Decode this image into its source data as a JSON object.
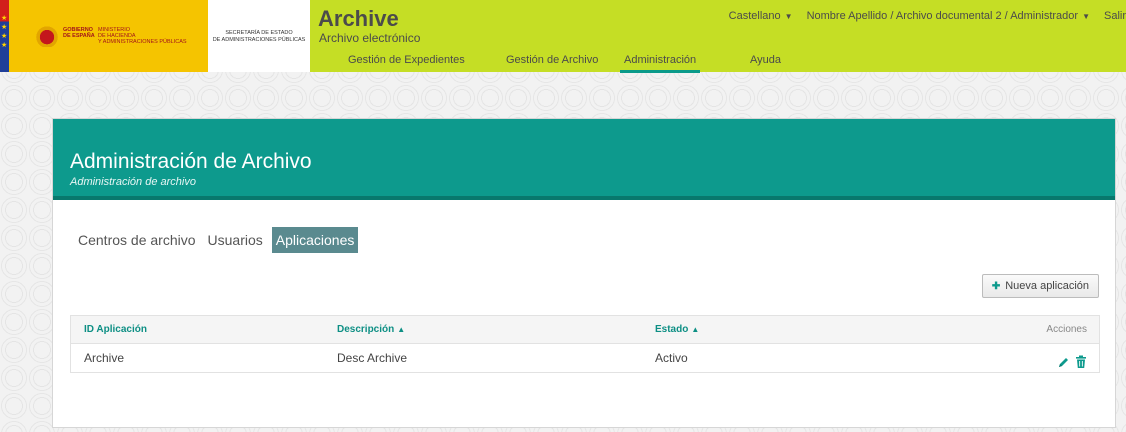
{
  "header": {
    "gov_line1": "GOBIERNO",
    "gov_line2": "DE ESPAÑA",
    "ministry_line1": "MINISTERIO",
    "ministry_line2": "DE HACIENDA",
    "ministry_line3": "Y ADMINISTRACIONES PÚBLICAS",
    "secretary_line1": "SECRETARÍA DE ESTADO",
    "secretary_line2": "DE ADMINISTRACIONES PÚBLICAS",
    "app_title": "Archive",
    "app_subtitle": "Archivo electrónico",
    "language": "Castellano",
    "user": "Nombre Apellido / Archivo documental 2 / Administrador",
    "logout": "Salir",
    "nav": [
      {
        "label": "Gestión de Expedientes"
      },
      {
        "label": "Gestión de Archivo"
      },
      {
        "label": "Administración"
      },
      {
        "label": "Ayuda"
      }
    ]
  },
  "panel": {
    "title": "Administración de Archivo",
    "subtitle": "Administración de archivo",
    "tabs": [
      {
        "label": "Centros de archivo"
      },
      {
        "label": "Usuarios"
      },
      {
        "label": "Aplicaciones"
      }
    ],
    "new_button": "Nueva aplicación"
  },
  "table": {
    "columns": [
      "ID Aplicación",
      "Descripción",
      "Estado",
      "Acciones"
    ],
    "rows": [
      {
        "id": "Archive",
        "description": "Desc Archive",
        "status": "Activo"
      }
    ]
  },
  "colors": {
    "accent": "#0d9a8d",
    "header_bar": "#c5de25",
    "gov_yellow": "#f5c400"
  },
  "icons": [
    "edit-icon",
    "trash-icon",
    "plus-icon",
    "caret-down-icon",
    "sort-asc-icon"
  ]
}
